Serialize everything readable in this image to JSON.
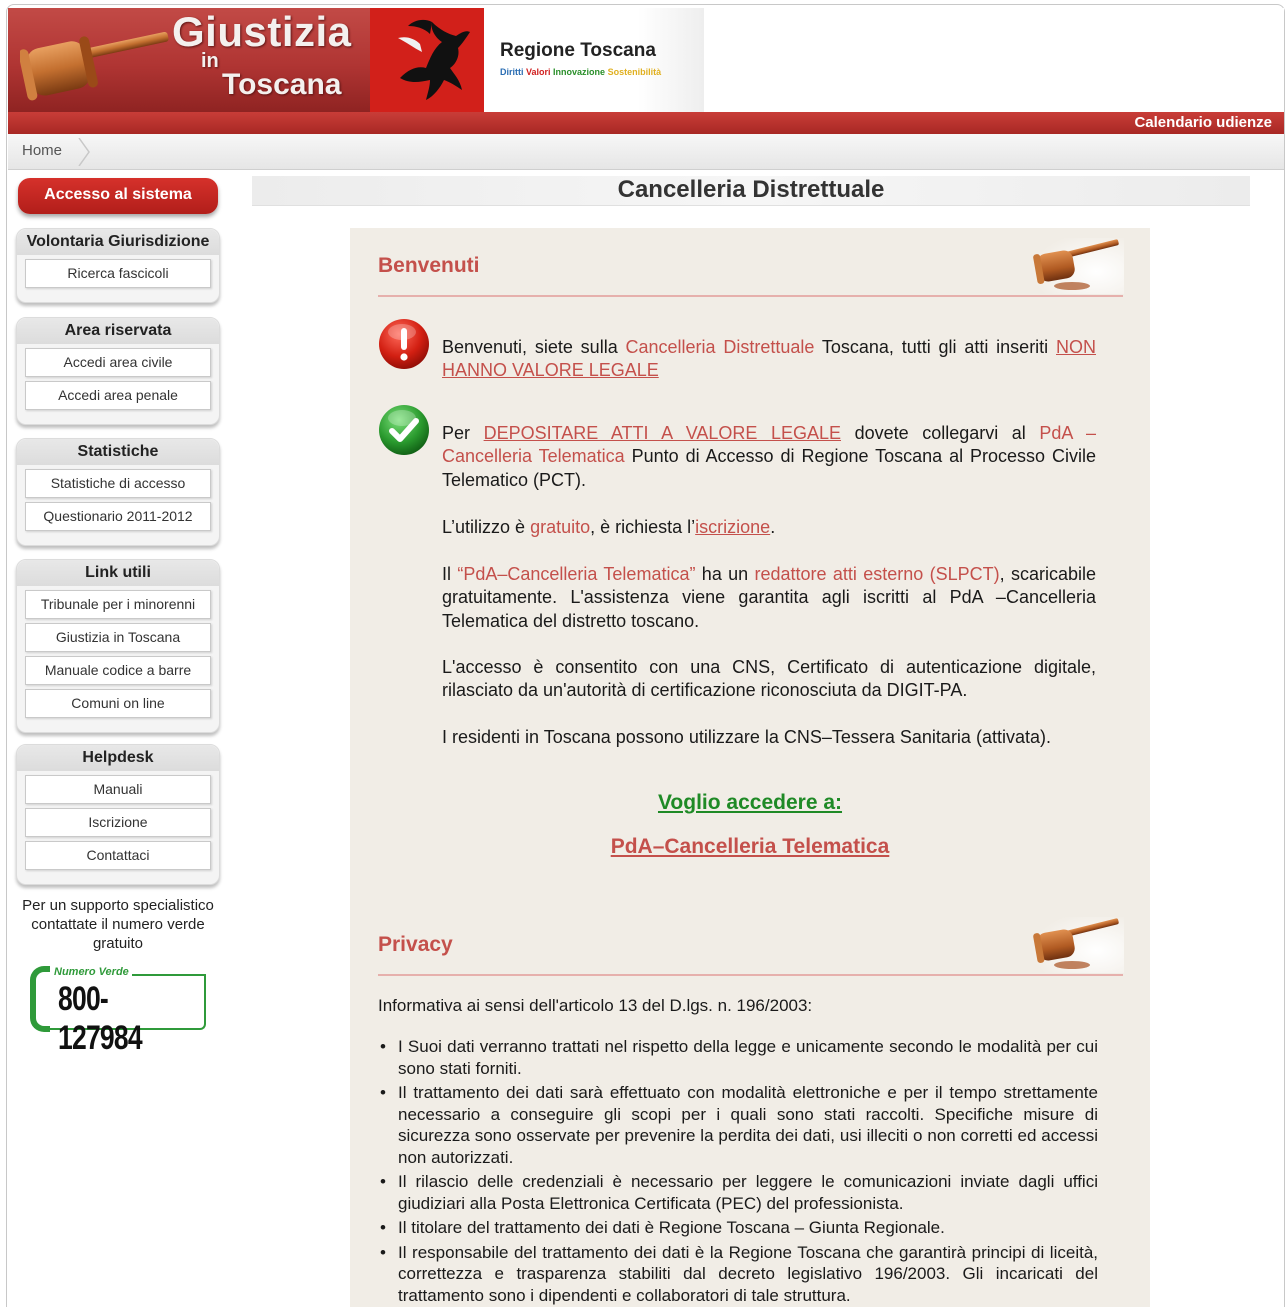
{
  "header": {
    "logo_line1": "Giustizia",
    "logo_line2": "in",
    "logo_line3": "Toscana",
    "regione_name": "Regione Toscana",
    "regione_motto": [
      "Diritti",
      "Valori",
      "Innovazione",
      "Sostenibilità"
    ],
    "calendar_link": "Calendario udienze"
  },
  "breadcrumb": {
    "home": "Home"
  },
  "sidebar": {
    "access_button": "Accesso al sistema",
    "groups": [
      {
        "title": "Volontaria Giurisdizione",
        "items": [
          "Ricerca fascicoli"
        ]
      },
      {
        "title": "Area riservata",
        "items": [
          "Accedi area civile",
          "Accedi area penale"
        ]
      },
      {
        "title": "Statistiche",
        "items": [
          "Statistiche di accesso",
          "Questionario 2011-2012"
        ]
      },
      {
        "title": "Link utili",
        "items": [
          "Tribunale per i minorenni",
          "Giustizia in Toscana",
          "Manuale codice a barre",
          "Comuni on line"
        ]
      },
      {
        "title": "Helpdesk",
        "items": [
          "Manuali",
          "Iscrizione",
          "Contattaci"
        ]
      }
    ],
    "support_text": "Per un supporto specialistico contattate il numero verde gratuito",
    "numero_verde_label": "Numero Verde",
    "numero_verde": "800-127984"
  },
  "page": {
    "title": "Cancelleria Distrettuale"
  },
  "welcome": {
    "title": "Benvenuti",
    "p1_a": "Benvenuti, siete sulla ",
    "p1_link1": "Cancelleria Distrettuale",
    "p1_b": " Toscana, tutti gli atti inseriti ",
    "p1_link2": "NON HANNO VALORE LEGALE",
    "p2_a": "Per ",
    "p2_link1": "DEPOSITARE ATTI A VALORE LEGALE",
    "p2_b": " dovete collegarvi al ",
    "p2_link2": "PdA –Cancelleria Telematica",
    "p2_c": " Punto di Accesso di Regione Toscana al Processo Civile Telematico (PCT).",
    "p3_a": "L’utilizzo è ",
    "p3_link1": "gratuito",
    "p3_b": ", è richiesta l’",
    "p3_link2": "iscrizione",
    "p3_c": ".",
    "p4_a": "Il ",
    "p4_link1": "“PdA–Cancelleria Telematica”",
    "p4_b": " ha un ",
    "p4_link2": "redattore atti esterno (SLPCT)",
    "p4_c": ", scaricabile gratuitamente. L'assistenza viene garantita agli iscritti al PdA –Cancelleria Telematica del distretto toscano.",
    "p5": "L'accesso è consentito con una CNS, Certificato di autenticazione digitale, rilasciato da un'autorità di certificazione riconosciuta da DIGIT-PA.",
    "p6": "I residenti in Toscana possono utilizzare la CNS–Tessera Sanitaria (attivata).",
    "cta_heading": "Voglio accedere a:",
    "cta_link": "PdA–Cancelleria Telematica"
  },
  "privacy": {
    "title": "Privacy",
    "intro": "Informativa ai sensi dell'articolo 13 del D.lgs. n. 196/2003:",
    "items": [
      "I Suoi dati verranno trattati nel rispetto della legge e unicamente secondo le modalità per cui sono stati forniti.",
      "Il trattamento dei dati sarà effettuato con modalità elettroniche e per il tempo strettamente necessario a conseguire gli scopi per i quali sono stati raccolti. Specifiche misure di sicurezza sono osservate per prevenire la perdita dei dati, usi illeciti o non corretti ed accessi non autorizzati.",
      "Il rilascio delle credenziali è necessario per leggere le comunicazioni inviate dagli uffici giudiziari alla Posta Elettronica Certificata (PEC) del professionista.",
      "Il titolare del trattamento dei dati è Regione Toscana – Giunta Regionale.",
      "Il responsabile del trattamento dei dati è la Regione Toscana che garantirà principi di liceità, correttezza e trasparenza stabiliti dal decreto legislativo 196/2003. Gli incaricati del trattamento sono i dipendenti e collaboratori di tale struttura."
    ]
  },
  "colors": {
    "brand_red": "#b03533",
    "link_red": "#c4504b",
    "cta_green": "#1f8a26",
    "content_bg": "#f1ede6"
  }
}
